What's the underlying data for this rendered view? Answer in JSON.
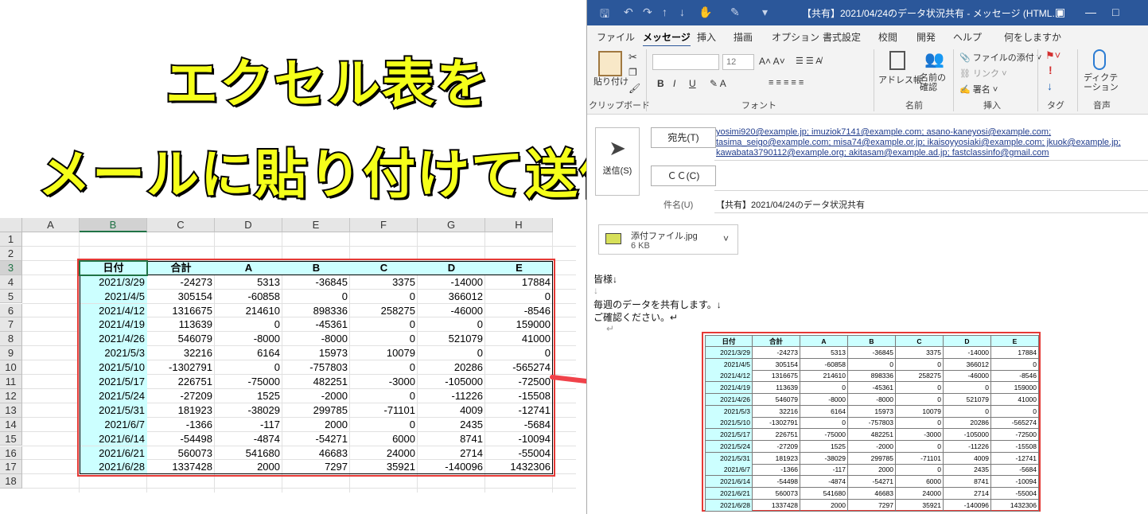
{
  "title": {
    "line1": "エクセル表を",
    "line2": "メールに貼り付けて送信"
  },
  "excel": {
    "columns": [
      "A",
      "B",
      "C",
      "D",
      "E",
      "F",
      "G",
      "H"
    ],
    "rows": [
      "1",
      "2",
      "3",
      "4",
      "5",
      "6",
      "7",
      "8",
      "9",
      "10",
      "11",
      "12",
      "13",
      "14",
      "15",
      "16",
      "17",
      "18"
    ],
    "headers": [
      "日付",
      "合計",
      "A",
      "B",
      "C",
      "D",
      "E"
    ],
    "data": [
      [
        "2021/3/29",
        "-24273",
        "5313",
        "-36845",
        "3375",
        "-14000",
        "17884"
      ],
      [
        "2021/4/5",
        "305154",
        "-60858",
        "0",
        "0",
        "366012",
        "0"
      ],
      [
        "2021/4/12",
        "1316675",
        "214610",
        "898336",
        "258275",
        "-46000",
        "-8546"
      ],
      [
        "2021/4/19",
        "113639",
        "0",
        "-45361",
        "0",
        "0",
        "159000"
      ],
      [
        "2021/4/26",
        "546079",
        "-8000",
        "-8000",
        "0",
        "521079",
        "41000"
      ],
      [
        "2021/5/3",
        "32216",
        "6164",
        "15973",
        "10079",
        "0",
        "0"
      ],
      [
        "2021/5/10",
        "-1302791",
        "0",
        "-757803",
        "0",
        "20286",
        "-565274"
      ],
      [
        "2021/5/17",
        "226751",
        "-75000",
        "482251",
        "-3000",
        "-105000",
        "-72500"
      ],
      [
        "2021/5/24",
        "-27209",
        "1525",
        "-2000",
        "0",
        "-11226",
        "-15508"
      ],
      [
        "2021/5/31",
        "181923",
        "-38029",
        "299785",
        "-71101",
        "4009",
        "-12741"
      ],
      [
        "2021/6/7",
        "-1366",
        "-117",
        "2000",
        "0",
        "2435",
        "-5684"
      ],
      [
        "2021/6/14",
        "-54498",
        "-4874",
        "-54271",
        "6000",
        "8741",
        "-10094"
      ],
      [
        "2021/6/21",
        "560073",
        "541680",
        "46683",
        "24000",
        "2714",
        "-55004"
      ],
      [
        "2021/6/28",
        "1337428",
        "2000",
        "7297",
        "35921",
        "-140096",
        "1432306"
      ]
    ]
  },
  "outlook": {
    "window_title": "【共有】2021/04/24のデータ状況共有 - メッセージ (HTML...",
    "tabs": [
      "ファイル",
      "メッセージ",
      "挿入",
      "描画",
      "オプション",
      "書式設定",
      "校閲",
      "開発",
      "ヘルプ",
      "何をしますか"
    ],
    "active_tab": "メッセージ",
    "ribbon": {
      "paste": "貼り付け",
      "clipboard": "クリップボード",
      "font_size": "12",
      "font_group": "フォント",
      "address_book": "アドレス帳",
      "check_names": "名前の確認",
      "names_group": "名前",
      "attach_file": "ファイルの添付",
      "link": "リンク",
      "signature": "署名",
      "insert_group": "挿入",
      "tags_group": "タグ",
      "dictate": "ディクテーション",
      "voice_group": "音声"
    },
    "send_label": "送信(S)",
    "to_label": "宛先(T)",
    "cc_label": "ＣＣ(C)",
    "subject_label": "件名(U)",
    "to_addresses": "yosimi920@example.jp; imuziok7141@example.com; asano-kaneyosi@example.com; tasima_seigo@example.com; misa74@example.or.jp; ikaisoyyosiaki@example.com; jkuok@example.jp; kawabata3790112@example.org; akitasam@example.ad.jp; fastclassinfo@gmail.com",
    "subject": "【共有】2021/04/24のデータ状況共有",
    "attachment_name": "添付ファイル.jpg",
    "attachment_size": "6 KB",
    "body_line1": "皆様↓",
    "body_line2": "↓",
    "body_line3": "毎週のデータを共有します。↓",
    "body_line4": "ご確認ください。↵",
    "body_line5": "↵"
  }
}
